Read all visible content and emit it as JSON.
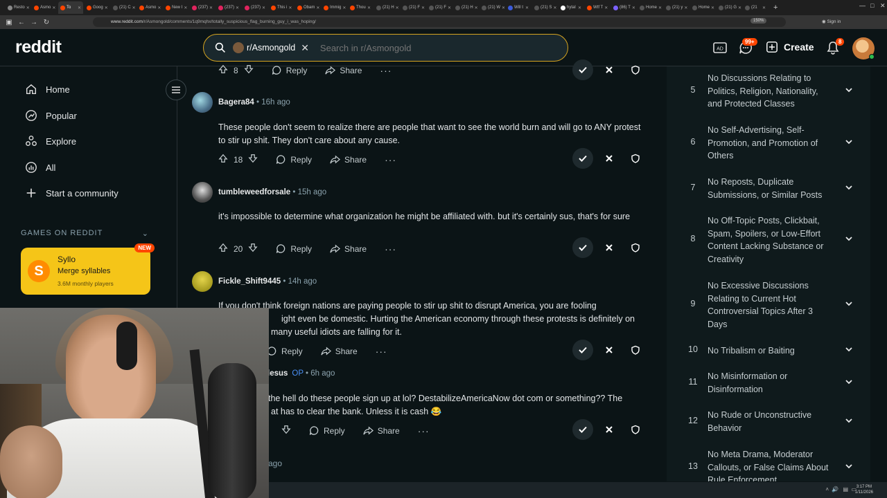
{
  "browser": {
    "tabs": [
      {
        "label": "Resto",
        "color": "#888888"
      },
      {
        "label": "Asmo",
        "color": "#ff4500"
      },
      {
        "label": "To",
        "color": "#ff4500",
        "active": true
      },
      {
        "label": "Goog",
        "color": "#ff4500"
      },
      {
        "label": "(21) C",
        "color": "#555555"
      },
      {
        "label": "Asmo",
        "color": "#ff4500"
      },
      {
        "label": "New I",
        "color": "#ff4500"
      },
      {
        "label": "(237)",
        "color": "#e0245e"
      },
      {
        "label": "(237)",
        "color": "#e0245e"
      },
      {
        "label": "(237)",
        "color": "#e0245e"
      },
      {
        "label": "This i",
        "color": "#ff4500"
      },
      {
        "label": "Obam",
        "color": "#ff4500"
      },
      {
        "label": "Immig",
        "color": "#ff4500"
      },
      {
        "label": "Thou",
        "color": "#ff4500"
      },
      {
        "label": "(21) H",
        "color": "#555555"
      },
      {
        "label": "(21) F",
        "color": "#555555"
      },
      {
        "label": "(21) F",
        "color": "#555555"
      },
      {
        "label": "(21) H",
        "color": "#555555"
      },
      {
        "label": "(21) W",
        "color": "#555555"
      },
      {
        "label": "Will t",
        "color": "#3b5bdb"
      },
      {
        "label": "(21) S",
        "color": "#555555"
      },
      {
        "label": "hytal",
        "color": "#ffffff"
      },
      {
        "label": "Wtf T",
        "color": "#ff4500"
      },
      {
        "label": "(86) T",
        "color": "#7b61ff"
      },
      {
        "label": "Home",
        "color": "#555555"
      },
      {
        "label": "(21) y",
        "color": "#555555"
      },
      {
        "label": "Home",
        "color": "#555555"
      },
      {
        "label": "(21) G",
        "color": "#555555"
      },
      {
        "label": "(21",
        "color": "#555555"
      }
    ],
    "url_host": "www.reddit.com",
    "url_path": "/r/Asmongold/comments/1q9mqhx/totally_suspicious_flag_burning_guy_i_was_hoping/",
    "zoom": "150%",
    "signin_label": "Sign in"
  },
  "header": {
    "logo": "reddit",
    "subreddit_chip": "r/Asmongold",
    "search_placeholder": "Search in r/Asmongold",
    "chat_badge": "99+",
    "create_label": "Create",
    "notif_badge": "8"
  },
  "sidebar": {
    "items": [
      {
        "label": "Home",
        "icon": "home-icon"
      },
      {
        "label": "Popular",
        "icon": "popular-icon"
      },
      {
        "label": "Explore",
        "icon": "explore-icon"
      },
      {
        "label": "All",
        "icon": "all-icon"
      },
      {
        "label": "Start a community",
        "icon": "plus-icon"
      }
    ],
    "games_header": "GAMES ON REDDIT",
    "game": {
      "name": "Syllo",
      "subtitle": "Merge syllables",
      "players": "3.6M monthly players",
      "badge": "NEW",
      "icon_letter": "S"
    }
  },
  "comments": [
    {
      "author": "Bagera84",
      "time": "16h ago",
      "body": "These people don't seem to realize there are people that want to see the world burn and will go to ANY protest to stir up shit. They don't care about any cause.",
      "votes": "18"
    },
    {
      "author": "tumbleweedforsale",
      "time": "15h ago",
      "body": "it's impossible to determine what organization he might be affiliated with. but it's certainly sus, that's for sure",
      "votes": "20"
    },
    {
      "author": "Fickle_Shift9445",
      "time": "14h ago",
      "body": "If you don't think foreign nations are paying people to stir up shit to disrupt America, you are fooling ...ight even be domestic. Hurting the American economy through these protests is definitely on ... many useful idiots are falling for it.",
      "body_lines": [
        "If you don't think foreign nations are paying people to stir up shit to disrupt America, you are fooling",
        "ight even be domestic. Hurting the American economy through these protests is definitely on",
        "many useful idiots are falling for it."
      ],
      "votes": ""
    },
    {
      "author": "lesus",
      "op_tag": "OP",
      "time": "6h ago",
      "body_lines": [
        "the hell do these people sign up at lol? DestabilizeAmericaNow dot com or something?? The",
        "at has to clear the bank. Unless it is cash 😂"
      ],
      "votes": ""
    }
  ],
  "top_row": {
    "votes": "8"
  },
  "partial_time": "ago",
  "action_labels": {
    "reply": "Reply",
    "share": "Share",
    "more": "···"
  },
  "rules": [
    {
      "num": "5",
      "text": "No Discussions Relating to Politics, Religion, Nationality, and Protected Classes"
    },
    {
      "num": "6",
      "text": "No Self-Advertising, Self-Promotion, and Promotion of Others"
    },
    {
      "num": "7",
      "text": "No Reposts, Duplicate Submissions, or Similar Posts"
    },
    {
      "num": "8",
      "text": "No Off-Topic Posts, Clickbait, Spam, Spoilers, or Low-Effort Content Lacking Substance or Creativity"
    },
    {
      "num": "9",
      "text": "No Excessive Discussions Relating to Current Hot Controversial Topics After 3 Days"
    },
    {
      "num": "10",
      "text": "No Tribalism or Baiting"
    },
    {
      "num": "11",
      "text": "No Misinformation or Disinformation"
    },
    {
      "num": "12",
      "text": "No Rude or Unconstructive Behavior"
    },
    {
      "num": "13",
      "text": "No Meta Drama, Moderator Callouts, or False Claims About Rule Enforcement"
    }
  ],
  "taskbar": {
    "time": "3:17 PM",
    "date": "1/11/2026"
  },
  "colors": {
    "accent": "#ff4500",
    "background": "#0b1416",
    "search_border": "#d7a520",
    "game_card": "#f5c518",
    "op_blue": "#4a8ff5"
  }
}
